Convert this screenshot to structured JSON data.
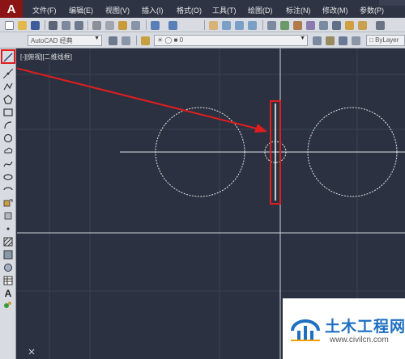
{
  "menubar": {
    "app_letter": "A",
    "items": [
      "文件(F)",
      "编辑(E)",
      "视图(V)",
      "插入(I)",
      "格式(O)",
      "工具(T)",
      "绘图(D)",
      "标注(N)",
      "修改(M)",
      "参数(P)"
    ]
  },
  "toolbar": {
    "workspace": "AutoCAD 经典",
    "layer_value": "0",
    "bylayer": "ByLayer"
  },
  "viewport": {
    "label": "[-][俯视][二维线框]"
  },
  "watermark": {
    "title": "土木工程网",
    "url": "www.civilcn.com"
  },
  "colors": {
    "canvas_bg": "#2b3140",
    "highlight": "#e21d1d",
    "brand_blue": "#1e6fc0"
  }
}
